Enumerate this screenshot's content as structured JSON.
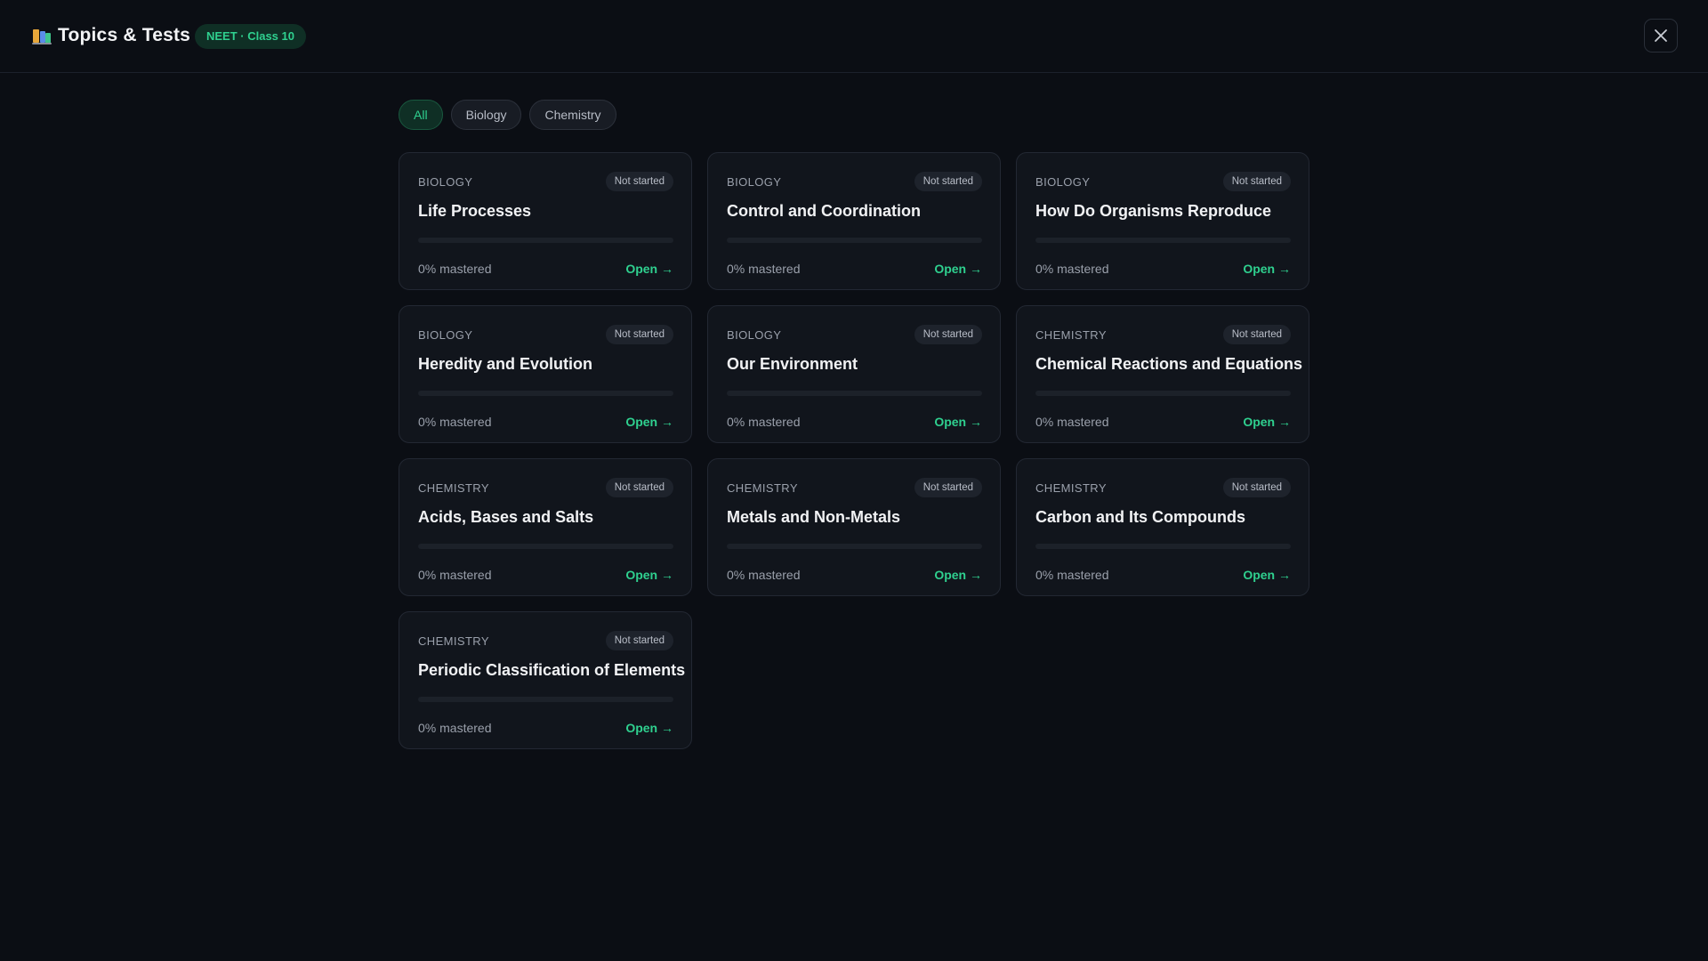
{
  "header": {
    "title": "Topics & Tests",
    "badge": "NEET · Class 10",
    "logo_icon": "books-icon",
    "close_icon": "close-icon"
  },
  "filters": [
    {
      "label": "All",
      "active": true
    },
    {
      "label": "Biology",
      "active": false
    },
    {
      "label": "Chemistry",
      "active": false
    }
  ],
  "colors": {
    "accent": "#2fd08f",
    "background": "#0b0e14",
    "card": "#11151c"
  },
  "topics": [
    {
      "subject": "BIOLOGY",
      "status": "Not started",
      "title": "Life Processes",
      "progress": 0,
      "mastered": "0% mastered",
      "action": "Open →"
    },
    {
      "subject": "BIOLOGY",
      "status": "Not started",
      "title": "Control and Coordination",
      "progress": 0,
      "mastered": "0% mastered",
      "action": "Open →"
    },
    {
      "subject": "BIOLOGY",
      "status": "Not started",
      "title": "How Do Organisms Reproduce",
      "progress": 0,
      "mastered": "0% mastered",
      "action": "Open →"
    },
    {
      "subject": "BIOLOGY",
      "status": "Not started",
      "title": "Heredity and Evolution",
      "progress": 0,
      "mastered": "0% mastered",
      "action": "Open →"
    },
    {
      "subject": "BIOLOGY",
      "status": "Not started",
      "title": "Our Environment",
      "progress": 0,
      "mastered": "0% mastered",
      "action": "Open →"
    },
    {
      "subject": "CHEMISTRY",
      "status": "Not started",
      "title": "Chemical Reactions and Equations",
      "progress": 0,
      "mastered": "0% mastered",
      "action": "Open →"
    },
    {
      "subject": "CHEMISTRY",
      "status": "Not started",
      "title": "Acids, Bases and Salts",
      "progress": 0,
      "mastered": "0% mastered",
      "action": "Open →"
    },
    {
      "subject": "CHEMISTRY",
      "status": "Not started",
      "title": "Metals and Non-Metals",
      "progress": 0,
      "mastered": "0% mastered",
      "action": "Open →"
    },
    {
      "subject": "CHEMISTRY",
      "status": "Not started",
      "title": "Carbon and Its Compounds",
      "progress": 0,
      "mastered": "0% mastered",
      "action": "Open →"
    },
    {
      "subject": "CHEMISTRY",
      "status": "Not started",
      "title": "Periodic Classification of Elements",
      "progress": 0,
      "mastered": "0% mastered",
      "action": "Open →"
    }
  ]
}
